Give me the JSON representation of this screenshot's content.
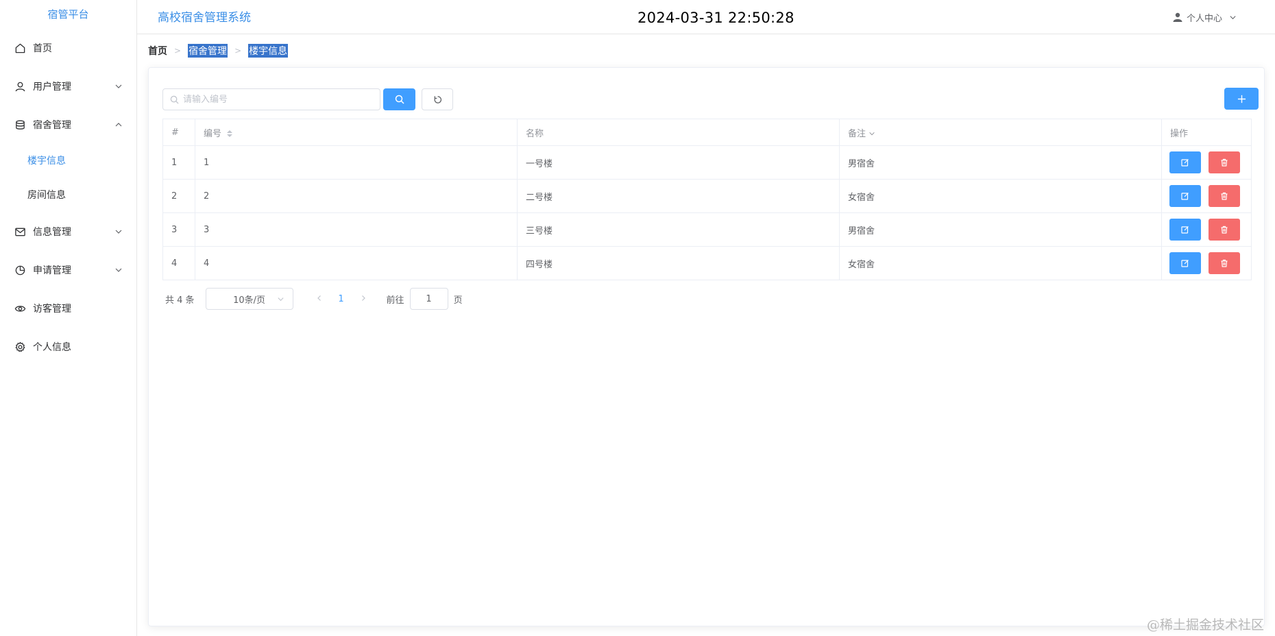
{
  "sidebar": {
    "brand": "宿管平台",
    "items": [
      {
        "label": "首页",
        "icon": "home-icon"
      },
      {
        "label": "用户管理",
        "icon": "user-icon",
        "arrow": "chevron-down-icon"
      },
      {
        "label": "宿舍管理",
        "icon": "database-icon",
        "arrow": "chevron-up-icon"
      },
      {
        "label": "信息管理",
        "icon": "message-icon",
        "arrow": "chevron-down-icon"
      },
      {
        "label": "申请管理",
        "icon": "pie-chart-icon",
        "arrow": "chevron-down-icon"
      },
      {
        "label": "访客管理",
        "icon": "eye-icon"
      },
      {
        "label": "个人信息",
        "icon": "gear-icon"
      }
    ],
    "sub_items": [
      {
        "label": "楼宇信息",
        "active": true
      },
      {
        "label": "房间信息",
        "active": false
      }
    ]
  },
  "header": {
    "system_title": "高校宿舍管理系统",
    "clock": "2024-03-31 22:50:28",
    "user_center": "个人中心"
  },
  "breadcrumb": [
    "首页",
    "宿舍管理",
    "楼宇信息"
  ],
  "toolbar": {
    "search_placeholder": "请输入编号",
    "search_value": ""
  },
  "table": {
    "columns": [
      "#",
      "编号",
      "名称",
      "备注",
      "操作"
    ],
    "rows": [
      {
        "index": "1",
        "code": "1",
        "name": "一号楼",
        "note": "男宿舍"
      },
      {
        "index": "2",
        "code": "2",
        "name": "二号楼",
        "note": "女宿舍"
      },
      {
        "index": "3",
        "code": "3",
        "name": "三号楼",
        "note": "男宿舍"
      },
      {
        "index": "4",
        "code": "4",
        "name": "四号楼",
        "note": "女宿舍"
      }
    ]
  },
  "pagination": {
    "total": "共 4 条",
    "page_size": "10条/页",
    "current_page": "1",
    "goto_label": "前往",
    "goto_value": "1",
    "page_suffix": "页"
  },
  "watermark": "@稀土掘金技术社区",
  "colors": {
    "primary": "#409eff",
    "danger": "#f56c6c",
    "brand": "#3a8ee6",
    "breadcrumb_selection": "#3874cb"
  }
}
